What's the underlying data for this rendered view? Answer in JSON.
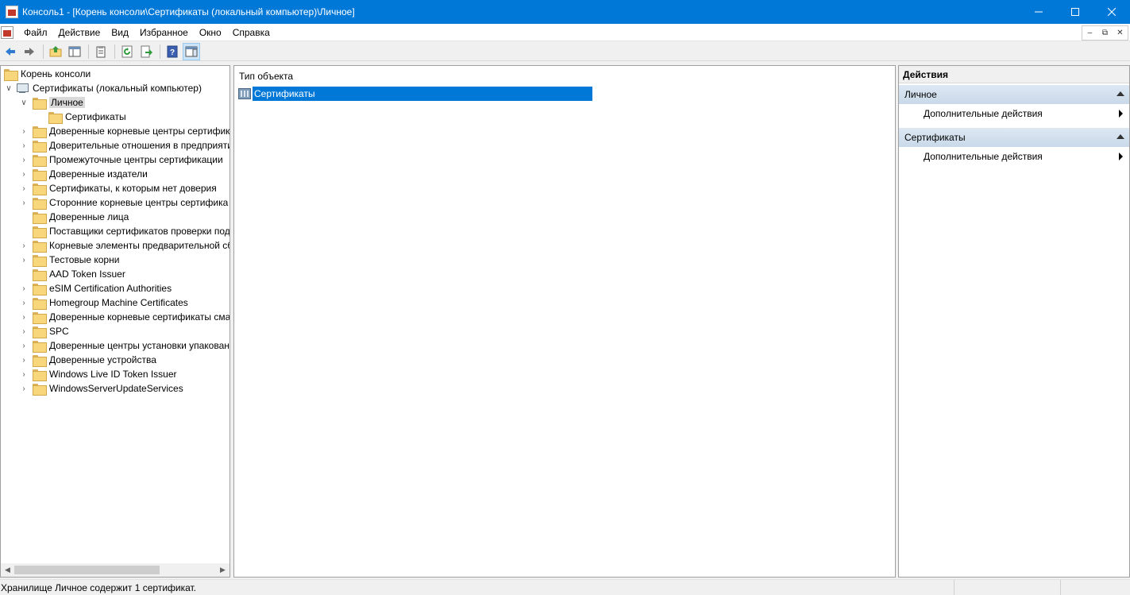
{
  "window": {
    "title": "Консоль1 - [Корень консоли\\Сертификаты (локальный компьютер)\\Личное]",
    "minimize_icon": "minimize-icon",
    "maximize_icon": "maximize-icon",
    "close_icon": "close-icon"
  },
  "menu": {
    "items": [
      "Файл",
      "Действие",
      "Вид",
      "Избранное",
      "Окно",
      "Справка"
    ]
  },
  "toolbar": {
    "buttons": [
      "back-icon",
      "forward-icon",
      "up-folder-icon",
      "show-hide-tree-icon",
      "properties-icon",
      "refresh-icon",
      "export-list-icon",
      "help-icon",
      "show-hide-action-pane-icon"
    ]
  },
  "tree": {
    "root": "Корень консоли",
    "computer": "Сертификаты (локальный компьютер)",
    "selected": "Личное",
    "personal_child": "Сертификаты",
    "stores": [
      "Доверенные корневые центры сертифик",
      "Доверительные отношения в предприяти",
      "Промежуточные центры сертификации",
      "Доверенные издатели",
      "Сертификаты, к которым нет доверия",
      "Сторонние корневые центры сертифика",
      "Доверенные лица",
      "Поставщики сертификатов проверки под",
      "Корневые элементы предварительной сб",
      "Тестовые корни",
      "AAD Token Issuer",
      "eSIM Certification Authorities",
      "Homegroup Machine Certificates",
      "Доверенные корневые сертификаты сма",
      "SPC",
      "Доверенные центры установки упакован",
      "Доверенные устройства",
      "Windows Live ID Token Issuer",
      "WindowsServerUpdateServices"
    ]
  },
  "center": {
    "column_header": "Тип объекта",
    "rows": [
      "Сертификаты"
    ]
  },
  "actions": {
    "title": "Действия",
    "sections": [
      {
        "name": "Личное",
        "item": "Дополнительные действия"
      },
      {
        "name": "Сертификаты",
        "item": "Дополнительные действия"
      }
    ]
  },
  "status": {
    "text": "Хранилище Личное содержит 1 сертификат."
  }
}
